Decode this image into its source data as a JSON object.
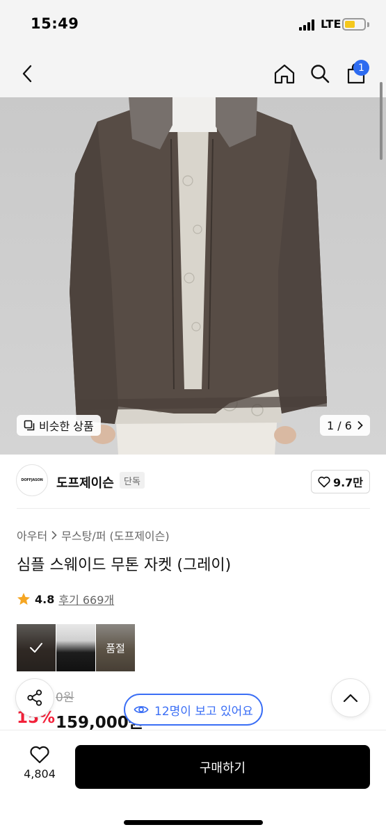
{
  "status_bar": {
    "time": "15:49",
    "network": "LTE"
  },
  "header": {
    "cart_badge": "1"
  },
  "hero": {
    "similar_label": "비슷한 상품",
    "page_indicator": "1 / 6"
  },
  "brand": {
    "logo_text": "DOFFJASON",
    "name": "도프제이슨",
    "tag": "단독",
    "likes": "9.7만"
  },
  "product": {
    "category": "아우터",
    "subcategory": "무스탕/퍼 (도프제이슨)",
    "title": "심플 스웨이드 무톤 자켓 (그레이)",
    "rating": "4.8",
    "reviews": "후기 669개",
    "swatches": [
      {
        "color": "#4a3f38",
        "selected": true,
        "soldout_label": ""
      },
      {
        "color": "#111111",
        "selected": false,
        "soldout_label": ""
      },
      {
        "color": "#8d7f6b",
        "selected": false,
        "soldout_label": "품절"
      }
    ],
    "original_price": "0원",
    "discount": "15%",
    "sale_price": "159,000원"
  },
  "floating": {
    "viewers": "12명이 보고 있어요"
  },
  "bottom": {
    "wish_count": "4,804",
    "buy_label": "구매하기"
  },
  "colors": {
    "accent_blue": "#3a6ef5",
    "discount_red": "#f3213a",
    "badge_blue": "#2d6bf0"
  }
}
